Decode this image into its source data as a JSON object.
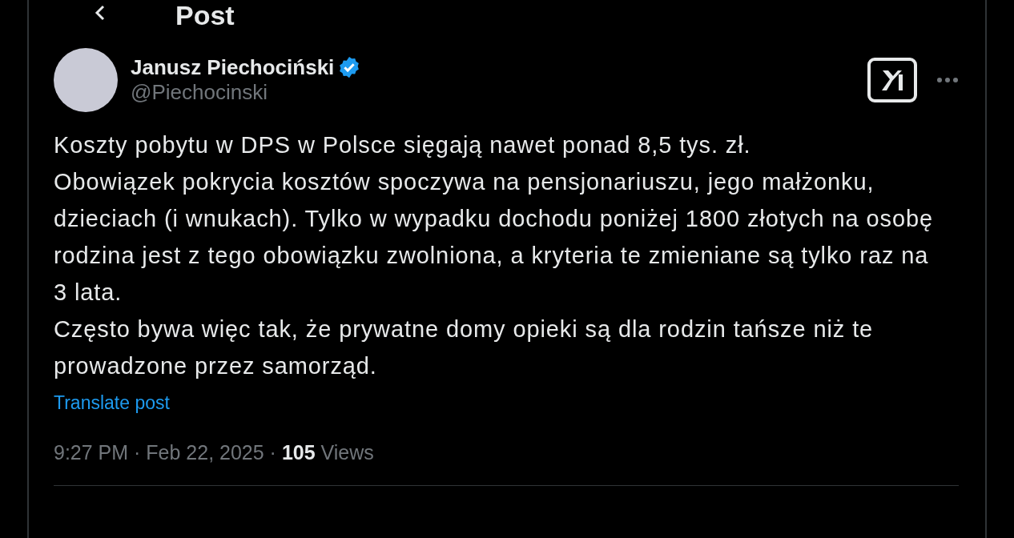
{
  "header": {
    "title": "Post"
  },
  "post": {
    "author": {
      "name": "Janusz Piechociński",
      "verified": true,
      "handle": "@Piechocinski"
    },
    "text": "Koszty pobytu w DPS w Polsce sięgają nawet ponad 8,5 tys. zł.\nObowiązek pokrycia kosztów spoczywa na pensjonariuszu, jego małżonku, dzieciach (i wnukach). Tylko w wypadku dochodu poniżej 1800 złotych na osobę rodzina jest z tego obowiązku zwolniona, a kryteria te zmieniane są tylko raz na 3 lata.\nCzęsto bywa więc tak, że prywatne domy opieki są dla rodzin tańsze niż te prowadzone przez samorząd.",
    "translate_link": "Translate post",
    "meta": "9:27 PM · Feb 22, 2025 · **105** Views"
  }
}
